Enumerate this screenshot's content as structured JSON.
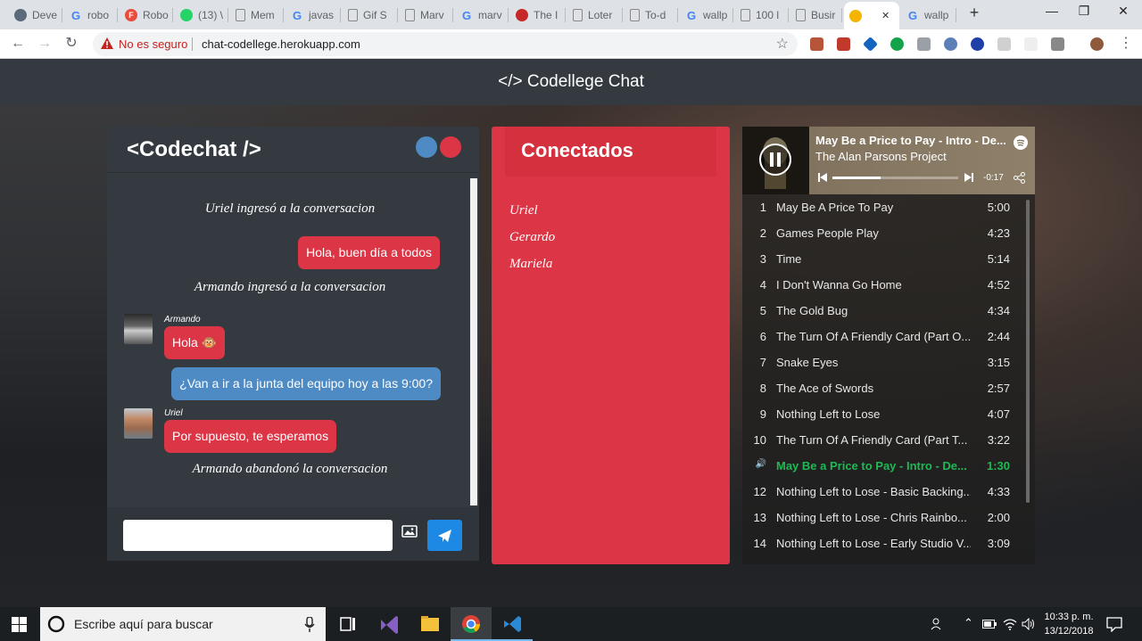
{
  "browser": {
    "tabs": [
      {
        "label": "Deve",
        "icon": "person-icon",
        "color": "#5a6a7a"
      },
      {
        "label": "robo",
        "icon": "google-icon",
        "color": "#4285f4"
      },
      {
        "label": "Robo",
        "icon": "f-icon",
        "color": "#e94b3c"
      },
      {
        "label": "(13) \\",
        "icon": "whatsapp-icon",
        "color": "#25d366"
      },
      {
        "label": "Mem",
        "icon": "page-icon",
        "color": "#888888"
      },
      {
        "label": "javas",
        "icon": "google-icon",
        "color": "#4285f4"
      },
      {
        "label": "Gif S",
        "icon": "page-icon",
        "color": "#888888"
      },
      {
        "label": "Marv",
        "icon": "page-icon",
        "color": "#888888"
      },
      {
        "label": "marv",
        "icon": "google-icon",
        "color": "#4285f4"
      },
      {
        "label": "The I",
        "icon": "hex-icon",
        "color": "#c62828"
      },
      {
        "label": "Loter",
        "icon": "page-icon",
        "color": "#888888"
      },
      {
        "label": "To-d",
        "icon": "page-icon",
        "color": "#888888"
      },
      {
        "label": "wallp",
        "icon": "google-icon",
        "color": "#4285f4"
      },
      {
        "label": "100 l",
        "icon": "page-icon",
        "color": "#888888"
      },
      {
        "label": "Busir",
        "icon": "page-icon",
        "color": "#888888"
      },
      {
        "label": "",
        "icon": "chat-icon",
        "color": "#f4b400"
      },
      {
        "label": "wallp",
        "icon": "google-icon",
        "color": "#4285f4"
      }
    ],
    "security": "No es seguro",
    "url": "chat-codellege.herokuapp.com"
  },
  "app": {
    "header": "</> Codellege Chat"
  },
  "chat": {
    "title": "<Codechat />",
    "messages": [
      {
        "type": "system",
        "text": "Uriel ingresó a la conversacion"
      },
      {
        "type": "own",
        "text": "Hola, buen día a todos"
      },
      {
        "type": "system",
        "text": "Armando ingresó a la conversacion"
      },
      {
        "type": "other",
        "user": "Armando",
        "text": "Hola 🐵"
      },
      {
        "type": "own-blue",
        "text": "¿Van a ir a la junta del equipo hoy a las 9:00?"
      },
      {
        "type": "other",
        "user": "Uriel",
        "text": "Por supuesto, te esperamos"
      },
      {
        "type": "system",
        "text": "Armando abandonó la conversacion"
      }
    ],
    "input_placeholder": ""
  },
  "connected": {
    "title": "Conectados",
    "users": [
      "Uriel",
      "Gerardo",
      "Mariela"
    ]
  },
  "spotify": {
    "now_playing_title": "May Be a Price to Pay - Intro - De...",
    "now_playing_artist": "The Alan Parsons Project",
    "remaining": "-0:17",
    "progress": 0.38,
    "tracks": [
      {
        "n": "1",
        "title": "May Be A Price To Pay",
        "dur": "5:00"
      },
      {
        "n": "2",
        "title": "Games People Play",
        "dur": "4:23"
      },
      {
        "n": "3",
        "title": "Time",
        "dur": "5:14"
      },
      {
        "n": "4",
        "title": "I Don't Wanna Go Home",
        "dur": "4:52"
      },
      {
        "n": "5",
        "title": "The Gold Bug",
        "dur": "4:34"
      },
      {
        "n": "6",
        "title": "The Turn Of A Friendly Card (Part O...",
        "dur": "2:44"
      },
      {
        "n": "7",
        "title": "Snake Eyes",
        "dur": "3:15"
      },
      {
        "n": "8",
        "title": "The Ace of Swords",
        "dur": "2:57"
      },
      {
        "n": "9",
        "title": "Nothing Left to Lose",
        "dur": "4:07"
      },
      {
        "n": "10",
        "title": "The Turn Of A Friendly Card (Part T...",
        "dur": "3:22"
      },
      {
        "n": "",
        "title": "May Be a Price to Pay - Intro - De...",
        "dur": "1:30",
        "playing": true
      },
      {
        "n": "12",
        "title": "Nothing Left to Lose - Basic Backing...",
        "dur": "4:33"
      },
      {
        "n": "13",
        "title": "Nothing Left to Lose - Chris Rainbo...",
        "dur": "2:00"
      },
      {
        "n": "14",
        "title": "Nothing Left to Lose - Early Studio V...",
        "dur": "3:09"
      }
    ]
  },
  "taskbar": {
    "search": "Escribe aquí para buscar",
    "time": "10:33 p. m.",
    "date": "13/12/2018"
  },
  "colors": {
    "accent_red": "#dc3545",
    "bubble_blue": "#4e8bc4",
    "panel_dark": "#343a40",
    "spotify_green": "#1db954",
    "send_blue": "#1e88e5"
  }
}
